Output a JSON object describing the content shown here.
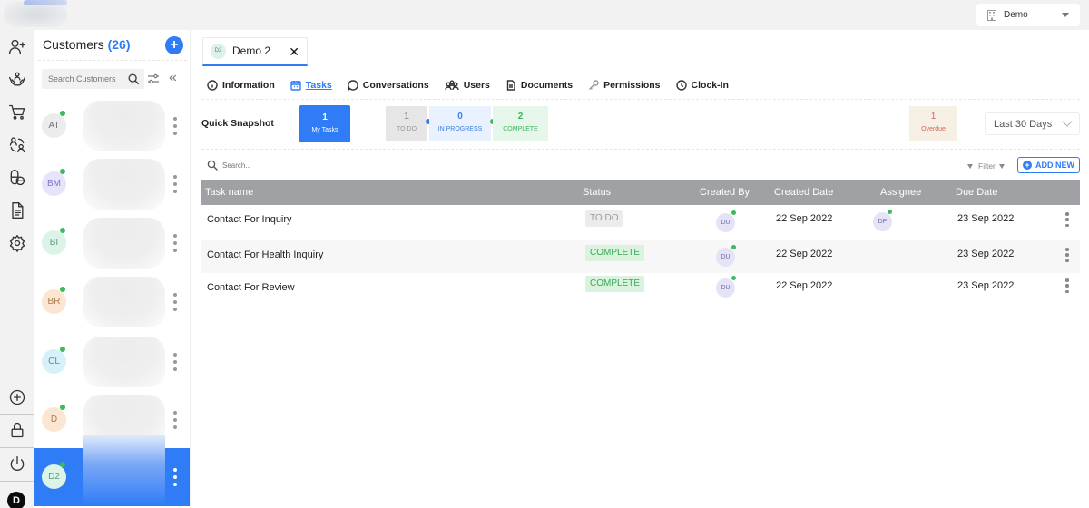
{
  "org_selector": {
    "label": "Demo",
    "icon": "building-icon"
  },
  "rail": {
    "items": [
      {
        "name": "add-user-icon"
      },
      {
        "name": "care-hands-icon"
      },
      {
        "name": "cart-icon"
      },
      {
        "name": "switch-users-icon"
      },
      {
        "name": "pills-icon"
      },
      {
        "name": "document-icon"
      },
      {
        "name": "settings-icon"
      }
    ],
    "bottom": [
      {
        "name": "add-circle-icon"
      },
      {
        "name": "lock-icon"
      },
      {
        "name": "power-icon"
      }
    ],
    "profile_initial": "D"
  },
  "customers": {
    "title": "Customers",
    "count": "(26)",
    "search_placeholder": "Search Customers",
    "items": [
      {
        "initials": "AT",
        "bg": "#ececec",
        "fg": "#6a6f7a",
        "online": true,
        "active": false
      },
      {
        "initials": "BM",
        "bg": "#e6e4fa",
        "fg": "#7a76c4",
        "online": true,
        "active": false
      },
      {
        "initials": "BI",
        "bg": "#dcf3e8",
        "fg": "#5f9a7e",
        "online": true,
        "active": false
      },
      {
        "initials": "BR",
        "bg": "#fbe6d2",
        "fg": "#b07a4a",
        "online": true,
        "active": false
      },
      {
        "initials": "CL",
        "bg": "#d6f2f8",
        "fg": "#4f8ea0",
        "online": true,
        "active": false
      },
      {
        "initials": "D",
        "bg": "#fbe6d2",
        "fg": "#b07a4a",
        "online": true,
        "active": false
      },
      {
        "initials": "D2",
        "bg": "#dcf3e8",
        "fg": "#5f9a7e",
        "online": true,
        "active": true
      }
    ]
  },
  "customer_tab": {
    "initials": "D2",
    "name": "Demo 2",
    "close": "✕"
  },
  "subtabs": [
    {
      "label": "Information",
      "icon": "info-icon",
      "active": false
    },
    {
      "label": "Tasks",
      "icon": "calendar-icon",
      "active": true
    },
    {
      "label": "Conversations",
      "icon": "chat-icon",
      "active": false
    },
    {
      "label": "Users",
      "icon": "users-icon",
      "active": false
    },
    {
      "label": "Documents",
      "icon": "file-icon",
      "active": false
    },
    {
      "label": "Permissions",
      "icon": "key-icon",
      "active": false
    },
    {
      "label": "Clock-In",
      "icon": "clock-icon",
      "active": false
    }
  ],
  "snapshot": {
    "label": "Quick Snapshot",
    "my_tasks": {
      "count": "1",
      "label": "My Tasks"
    },
    "todo": {
      "count": "1",
      "label": "TO DO"
    },
    "in_progress": {
      "count": "0",
      "label": "IN PROGRESS"
    },
    "complete": {
      "count": "2",
      "label": "COMPLETE"
    },
    "overdue": {
      "count": "1",
      "label": "Overdue"
    },
    "range": "Last 30 Days"
  },
  "toolbar": {
    "search_placeholder": "Search...",
    "filter_label": "Filter",
    "add_new_label": "ADD NEW"
  },
  "table": {
    "columns": [
      "Task name",
      "Status",
      "Created By",
      "Created Date",
      "Assignee",
      "Due Date"
    ],
    "rows": [
      {
        "task": "Contact For Inquiry",
        "status": "TO DO",
        "status_type": "todo",
        "created_by": "DU",
        "created_date": "22 Sep 2022",
        "assignee": "DP",
        "due_date": "23 Sep 2022"
      },
      {
        "task": "Contact For Health Inquiry",
        "status": "COMPLETE",
        "status_type": "complete",
        "created_by": "DU",
        "created_date": "22 Sep 2022",
        "assignee": "",
        "due_date": "23 Sep 2022"
      },
      {
        "task": "Contact For Review",
        "status": "COMPLETE",
        "status_type": "complete",
        "created_by": "DU",
        "created_date": "22 Sep 2022",
        "assignee": "",
        "due_date": "23 Sep 2022"
      }
    ]
  },
  "colors": {
    "accent": "#2f7cf6",
    "online": "#3cb95a",
    "header_gray": "#9fa1a4",
    "overdue": "#e06050"
  }
}
